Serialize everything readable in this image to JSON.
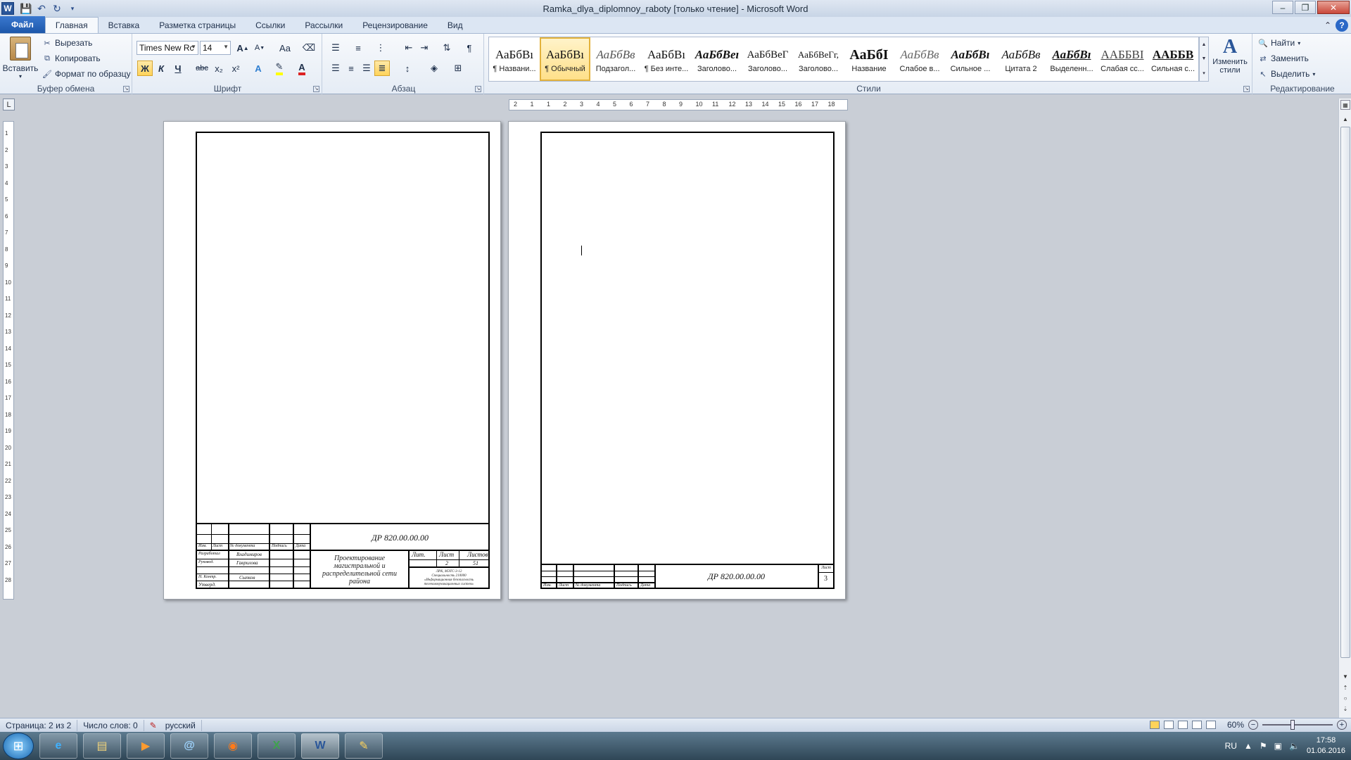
{
  "window": {
    "title": "Ramka_dlya_diplomnoy_raboty [только чтение] - Microsoft Word"
  },
  "tabs": [
    {
      "label": "Файл"
    },
    {
      "label": "Главная"
    },
    {
      "label": "Вставка"
    },
    {
      "label": "Разметка страницы"
    },
    {
      "label": "Ссылки"
    },
    {
      "label": "Рассылки"
    },
    {
      "label": "Рецензирование"
    },
    {
      "label": "Вид"
    }
  ],
  "clipboard": {
    "paste": "Вставить",
    "cut": "Вырезать",
    "copy": "Копировать",
    "format_painter": "Формат по образцу",
    "group": "Буфер обмена"
  },
  "font": {
    "name": "Times New Rc",
    "size": "14",
    "group": "Шрифт",
    "bold": "Ж",
    "italic": "К",
    "underline": "Ч",
    "strike": "abc",
    "sub": "x₂",
    "sup": "x²",
    "grow": "A",
    "shrink": "A",
    "case": "Aa"
  },
  "paragraph": {
    "group": "Абзац"
  },
  "styles": {
    "group": "Стили",
    "items": [
      {
        "sample": "АаБбВı",
        "name": "¶ Названи..."
      },
      {
        "sample": "АаБбВı",
        "name": "¶ Обычный"
      },
      {
        "sample": "АаБбВв",
        "name": "Подзагол..."
      },
      {
        "sample": "АаБбВı",
        "name": "¶ Без инте..."
      },
      {
        "sample": "АаБбВеı",
        "name": "Заголово..."
      },
      {
        "sample": "АаБбВеГ",
        "name": "Заголово..."
      },
      {
        "sample": "АаБбВеГг,",
        "name": "Заголово..."
      },
      {
        "sample": "АаБбІ",
        "name": "Название"
      },
      {
        "sample": "АаБбВв",
        "name": "Слабое в..."
      },
      {
        "sample": "АаБбВı",
        "name": "Сильное ..."
      },
      {
        "sample": "АаБбВв",
        "name": "Цитата 2"
      },
      {
        "sample": "АаБбВı",
        "name": "Выделенн..."
      },
      {
        "sample": "ААББВІ",
        "name": "Слабая сс..."
      },
      {
        "sample": "ААББВ",
        "name": "Сильная с..."
      }
    ],
    "change": "Изменить стили"
  },
  "editing": {
    "group": "Редактирование",
    "find": "Найти",
    "replace": "Заменить",
    "select": "Выделить"
  },
  "ruler": {
    "h_numbers": [
      "2",
      "1",
      "1",
      "2",
      "3",
      "4",
      "5",
      "6",
      "7",
      "8",
      "9",
      "10",
      "11",
      "12",
      "13",
      "14",
      "15",
      "16",
      "17",
      "18"
    ],
    "v_numbers": [
      "1",
      "2",
      "3",
      "4",
      "5",
      "6",
      "7",
      "8",
      "9",
      "10",
      "11",
      "12",
      "13",
      "14",
      "15",
      "16",
      "17",
      "18",
      "19",
      "20",
      "21",
      "22",
      "23",
      "24",
      "25",
      "26",
      "27",
      "28"
    ]
  },
  "page1": {
    "code": "ДР 820.00.00.00",
    "title_lines": [
      "Проектирование",
      "магистральной и",
      "распределительной сети",
      "района"
    ],
    "hdr": [
      "Изм.",
      "Лист",
      "№ документа",
      "Подпись",
      "Дата"
    ],
    "roles": [
      "Разработал",
      "Руковод.",
      "Н. Контр.",
      "Утверд."
    ],
    "names": [
      "Владимиров",
      "Гаврилова",
      "Сыпков"
    ],
    "lit": "Лит.",
    "sheet": "Лист",
    "sheets": "Листов",
    "sheet_num": "2",
    "sheets_num": "51",
    "org": [
      "ЛРК, МЭТС-3-12",
      "Специальность 210000",
      "«Информационная безопасность",
      "телекоммуникационных систем»"
    ]
  },
  "page2": {
    "code": "ДР 820.00.00.00",
    "sheet_label": "Лист",
    "sheet_num": "3",
    "hdr": [
      "Изм.",
      "Лист",
      "№ документа",
      "Подпись",
      "Дата"
    ]
  },
  "status": {
    "page": "Страница: 2 из 2",
    "words": "Число слов: 0",
    "lang": "русский",
    "zoom": "60%"
  },
  "taskbar": {
    "apps": [
      "e",
      "▤",
      "▶",
      "@",
      "◉",
      "X",
      "W",
      "✎"
    ],
    "lang": "RU",
    "time": "17:58",
    "date": "01.06.2016"
  }
}
